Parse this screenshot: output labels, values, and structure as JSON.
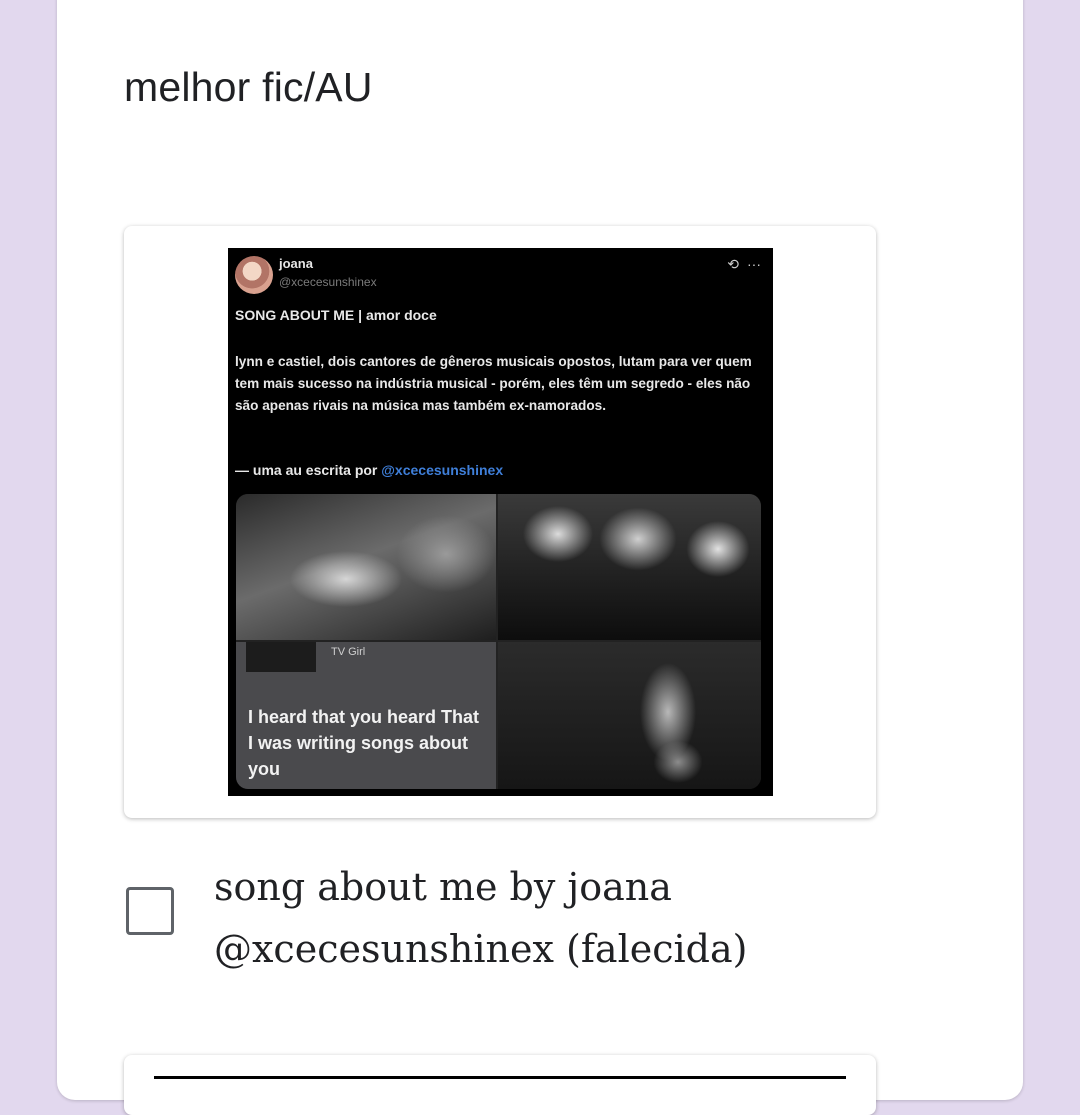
{
  "question": {
    "title": "melhor fic/AU"
  },
  "tweet": {
    "name": "joana",
    "handle": "@xcecesunshinex",
    "icons": [
      "repost-icon",
      "more-icon"
    ],
    "title": "SONG ABOUT ME | amor doce",
    "body": "lynn e castiel, dois cantores de gêneros musicais opostos, lutam para ver quem tem mais sucesso na indústria musical - porém, eles têm um segredo - eles não são apenas rivais na música mas também ex-namorados.",
    "credit_prefix": "— uma au escrita por ",
    "credit_mention": "@xcecesunshinex",
    "media": {
      "artist": "TV Girl",
      "lyrics": "I heard that you heard That I was writing songs about you"
    }
  },
  "option": {
    "label": "song about me by joana @xcecesunshinex (falecida)",
    "checked": false
  }
}
